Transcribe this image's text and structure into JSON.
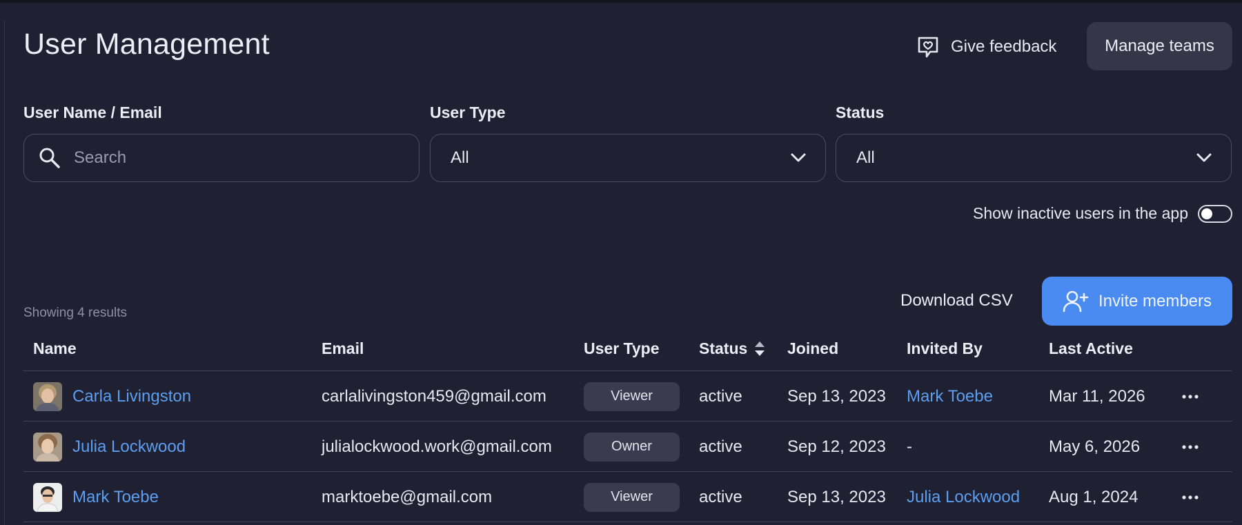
{
  "header": {
    "title": "User Management",
    "feedback_label": "Give feedback",
    "manage_teams_label": "Manage teams"
  },
  "filters": {
    "name_label": "User Name / Email",
    "search_placeholder": "Search",
    "user_type_label": "User Type",
    "user_type_value": "All",
    "status_label": "Status",
    "status_value": "All"
  },
  "toggle": {
    "label": "Show inactive users in the app",
    "on": false
  },
  "results_text": "Showing 4 results",
  "actions": {
    "download_csv": "Download CSV",
    "invite": "Invite members"
  },
  "table": {
    "columns": [
      "Name",
      "Email",
      "User Type",
      "Status",
      "Joined",
      "Invited By",
      "Last Active"
    ],
    "rows": [
      {
        "name": "Carla Livingston",
        "email": "carlalivingston459@gmail.com",
        "user_type": "Viewer",
        "status": "active",
        "joined": "Sep 13, 2023",
        "invited_by": "Mark Toebe",
        "last_active": "Mar 11, 2026"
      },
      {
        "name": "Julia Lockwood",
        "email": "julialockwood.work@gmail.com",
        "user_type": "Owner",
        "status": "active",
        "joined": "Sep 12, 2023",
        "invited_by": "-",
        "last_active": "May 6, 2026"
      },
      {
        "name": "Mark Toebe",
        "email": "marktoebe@gmail.com",
        "user_type": "Viewer",
        "status": "active",
        "joined": "Sep 13, 2023",
        "invited_by": "Julia Lockwood",
        "last_active": "Aug 1, 2024"
      }
    ]
  },
  "icons": {
    "feedback": "feedback-heart-icon",
    "search": "search-icon",
    "dropdown": "chevron-down-icon",
    "sort": "sort-icon",
    "invite": "add-user-icon",
    "more": "more-horizontal-icon"
  },
  "colors": {
    "background": "#1f2031",
    "accent": "#4a8bf2",
    "link": "#5c9ef0",
    "badge": "#3a3b4f"
  }
}
